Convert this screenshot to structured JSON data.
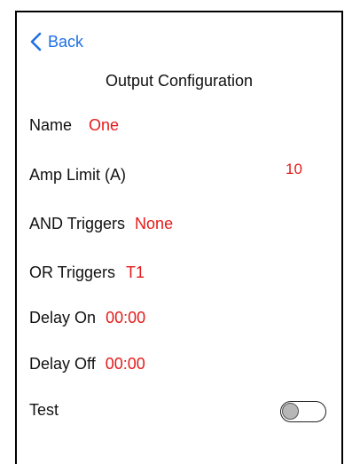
{
  "nav": {
    "back_label": "Back",
    "back_icon": "chevron-left-icon"
  },
  "header": {
    "title": "Output Configuration"
  },
  "fields": {
    "name": {
      "label": "Name",
      "value": "One"
    },
    "amp_limit": {
      "label": "Amp Limit (A)",
      "value": "10"
    },
    "and_triggers": {
      "label": "AND Triggers",
      "value": "None"
    },
    "or_triggers": {
      "label": "OR Triggers",
      "value": "T1"
    },
    "delay_on": {
      "label": "Delay On",
      "value": "00:00"
    },
    "delay_off": {
      "label": "Delay Off",
      "value": "00:00"
    },
    "test": {
      "label": "Test",
      "toggle_on": false
    }
  },
  "colors": {
    "accent": "#1e6fe6",
    "value": "#e51a1a",
    "text": "#111111"
  }
}
